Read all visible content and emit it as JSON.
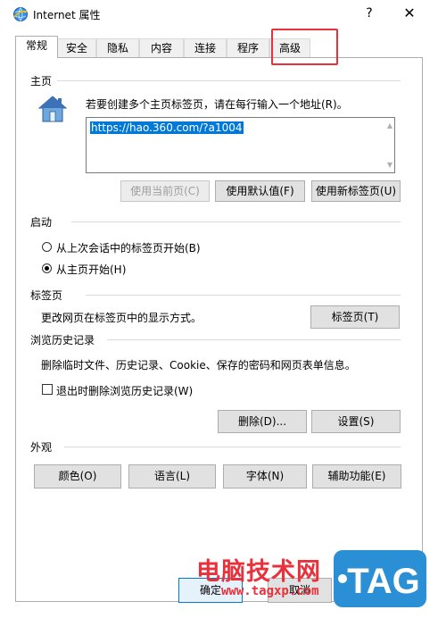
{
  "window": {
    "title": "Internet 属性",
    "help_label": "?",
    "close_label": "✕"
  },
  "tabs": [
    {
      "label": "常规",
      "active": true
    },
    {
      "label": "安全",
      "active": false
    },
    {
      "label": "隐私",
      "active": false
    },
    {
      "label": "内容",
      "active": false
    },
    {
      "label": "连接",
      "active": false
    },
    {
      "label": "程序",
      "active": false
    },
    {
      "label": "高级",
      "active": false
    }
  ],
  "homepage": {
    "section_label": "主页",
    "instruction": "若要创建多个主页标签页，请在每行输入一个地址(R)。",
    "url": "https://hao.360.com/?a1004",
    "btn_use_current": "使用当前页(C)",
    "btn_use_default": "使用默认值(F)",
    "btn_use_new_tab": "使用新标签页(U)"
  },
  "startup": {
    "section_label": "启动",
    "option_last_session": "从上次会话中的标签页开始(B)",
    "option_home_page": "从主页开始(H)",
    "selected": "option_home_page"
  },
  "tabs_section": {
    "section_label": "标签页",
    "description": "更改网页在标签页中的显示方式。",
    "btn_tabs": "标签页(T)"
  },
  "history": {
    "section_label": "浏览历史记录",
    "description": "删除临时文件、历史记录、Cookie、保存的密码和网页表单信息。",
    "checkbox_delete_on_exit": "退出时删除浏览历史记录(W)",
    "checkbox_checked": false,
    "btn_delete": "删除(D)...",
    "btn_settings": "设置(S)"
  },
  "appearance": {
    "section_label": "外观",
    "btn_colors": "颜色(O)",
    "btn_languages": "语言(L)",
    "btn_fonts": "字体(N)",
    "btn_accessibility": "辅助功能(E)"
  },
  "footer": {
    "btn_ok": "确定",
    "btn_cancel": "取消"
  },
  "watermark": {
    "text": "电脑技术网",
    "url": "www.tagxp.com",
    "logo_text": "TAG"
  },
  "colors": {
    "accent": "#0078d7",
    "highlight_red": "#e8313a"
  }
}
